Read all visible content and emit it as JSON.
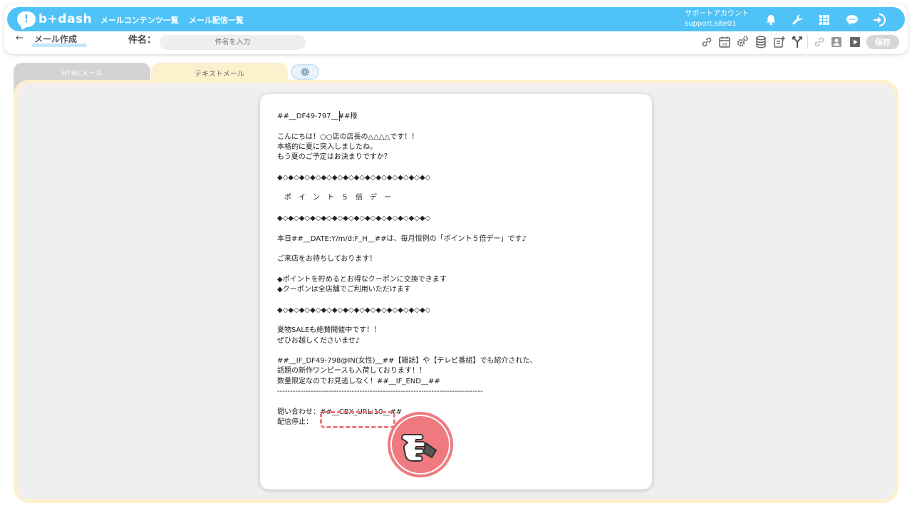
{
  "app": {
    "logo_text": "b+dash",
    "logo_mark": "!"
  },
  "nav": [
    {
      "label": "メールコンテンツ一覧"
    },
    {
      "label": "メール配信一覧"
    }
  ],
  "account": {
    "name": "サポートアカウント",
    "site": "support.site01"
  },
  "page": {
    "back_icon": "←",
    "title": "メール作成"
  },
  "subject": {
    "label": "件名：",
    "placeholder": "件名を入力",
    "value": ""
  },
  "save_label": "保存",
  "tabs": {
    "html": "HTMLメール",
    "text": "テキストメール"
  },
  "icons": {
    "top": [
      "bell-icon",
      "wrench-icon",
      "grid-icon",
      "chat-icon",
      "logout-icon"
    ],
    "tools": [
      "link-icon",
      "calendar-icon",
      "gears-icon",
      "database-icon",
      "add-doc-icon",
      "branch-icon",
      "link-off-icon",
      "user-card-icon",
      "play-icon"
    ]
  },
  "colors": {
    "brand": "#4fc3f7",
    "tab_active": "#fdf0cc",
    "highlight": "#ee7a7f"
  },
  "mail_body": "##__DF49-797__##様\n\nこんにちは！○○店の店長の△△△△です！！\n本格的に夏に突入しましたね。\nもう夏のご予定はお決まりですか？\n\n◆◇◆◇◆◇◆◇◆◇◆◇◆◇◆◇◆◇◆◇◆◇◆◇◆◇◆◇\n\n　ポ　イ　ン　ト　５　倍　デ　ー\n\n◆◇◆◇◆◇◆◇◆◇◆◇◆◇◆◇◆◇◆◇◆◇◆◇◆◇◆◇\n\n本日##__DATE:Y/m/d:F_H__##は、毎月恒例の「ポイント５倍デー」です♪\n\nご来店をお待ちしております！\n\n◆ポイントを貯めるとお得なクーポンに交換できます\n◆クーポンは全店舗でご利用いただけます\n\n◆◇◆◇◆◇◆◇◆◇◆◇◆◇◆◇◆◇◆◇◆◇◆◇◆◇◆◇\n\n夏物SALEも絶賛開催中です！！\nぜひお越しくださいませ♪\n\n##__IF_DF49-798@IN(女性)__##【雑誌】や【テレビ番組】でも紹介された、\n話題の新作ワンピースも入荷しております！！\n数量限定なのでお見逃しなく！##__IF_END__##\n--------------------------------------------------------------------------------\n\n問い合わせ：##__CBX_URL:10__##\n配信停止："
}
